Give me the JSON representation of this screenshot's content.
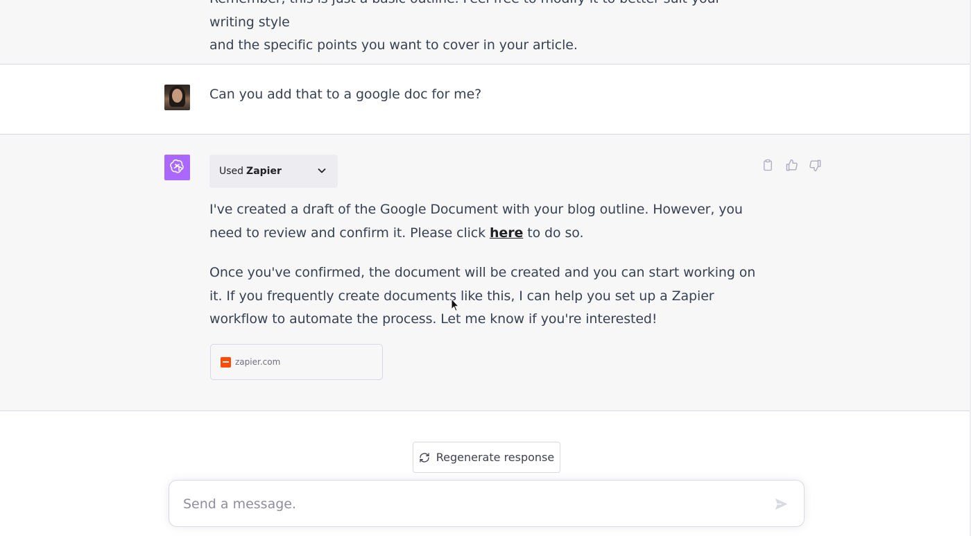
{
  "previous_message": {
    "lines": [
      "Remember, this is just a basic outline. Feel free to modify it to better suit your writing style",
      "and the specific points you want to cover in your article."
    ]
  },
  "user_message": {
    "text": "Can you add that to a google doc for me?"
  },
  "assistant_message": {
    "plugin": {
      "prefix": "Used",
      "name": "Zapier"
    },
    "paragraph1": {
      "before_link": "I've created a draft of the Google Document with your blog outline. However, you need to review and confirm it. Please click ",
      "link_text": "here",
      "after_link": " to do so."
    },
    "paragraph2": "Once you've confirmed, the document will be created and you can start working on it. If you frequently create documents like this, I can help you set up a Zapier workflow to automate the process. Let me know if you're interested!",
    "source": {
      "domain": "zapier.com",
      "favicon_color": "#ff4a00"
    },
    "actions": [
      "clipboard-icon",
      "thumbs-up-icon",
      "thumbs-down-icon"
    ]
  },
  "regenerate": {
    "label": "Regenerate response"
  },
  "composer": {
    "placeholder": "Send a message."
  },
  "colors": {
    "assistant_bg": "#f7f7f8",
    "gpt_avatar": "#ab68ff",
    "border": "#d9d9e3"
  }
}
